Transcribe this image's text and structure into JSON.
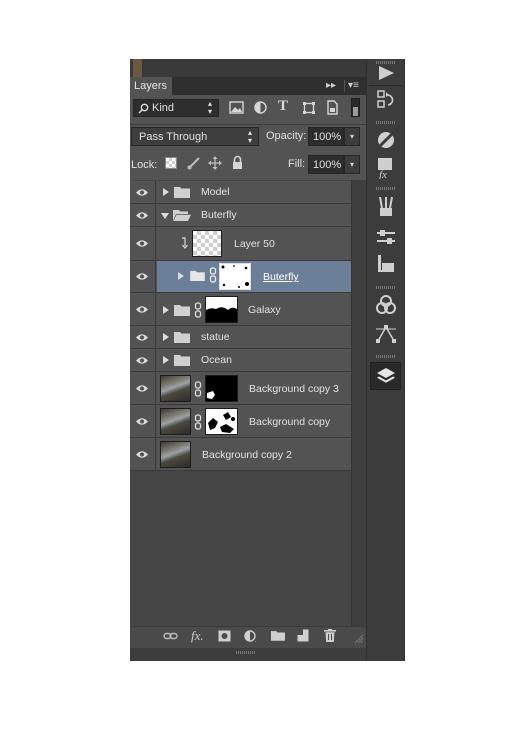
{
  "panel": {
    "tab_label": "Layers",
    "collapse_glyph": "▸▸",
    "menu_glyph": "≡"
  },
  "filter": {
    "kind_label": "Kind",
    "icons": [
      "pixel-filter-icon",
      "adjustment-filter-icon",
      "type-filter-icon",
      "shape-filter-icon",
      "smart-object-filter-icon"
    ]
  },
  "blend": {
    "mode": "Pass Through",
    "opacity_label": "Opacity:",
    "opacity_value": "100%",
    "lock_label": "Lock:",
    "fill_label": "Fill:",
    "fill_value": "100%"
  },
  "layers": [
    {
      "name": "Model",
      "type": "group",
      "expanded": false
    },
    {
      "name": "Buterfly",
      "type": "group",
      "expanded": true
    },
    {
      "name": "Layer 50",
      "type": "layer",
      "clipped": true
    },
    {
      "name": "Buterfly",
      "type": "group",
      "expanded": false,
      "mask": true,
      "selected": true
    },
    {
      "name": "Galaxy",
      "type": "group",
      "expanded": false,
      "mask": true
    },
    {
      "name": "statue",
      "type": "group",
      "expanded": false
    },
    {
      "name": "Ocean",
      "type": "group",
      "expanded": false
    },
    {
      "name": "Background copy 3",
      "type": "layer",
      "mask": true
    },
    {
      "name": "Background copy",
      "type": "layer",
      "mask": true
    },
    {
      "name": "Background copy 2",
      "type": "layer"
    }
  ],
  "footer_icons": [
    "link-layers-icon",
    "fx-icon",
    "add-mask-icon",
    "adjustment-layer-icon",
    "new-group-icon",
    "new-layer-icon",
    "trash-icon"
  ],
  "footer": {
    "fx_label": "fx."
  },
  "side_icons": [
    "play-icon",
    "history-icon",
    "adjustments-icon",
    "styles-icon",
    "brush-presets-icon",
    "properties-icon",
    "character-icon",
    "channels-icon",
    "paths-icon",
    "layers-icon"
  ],
  "colors": {
    "selected_row": "#6c7f99",
    "panel_bg": "#535353"
  }
}
